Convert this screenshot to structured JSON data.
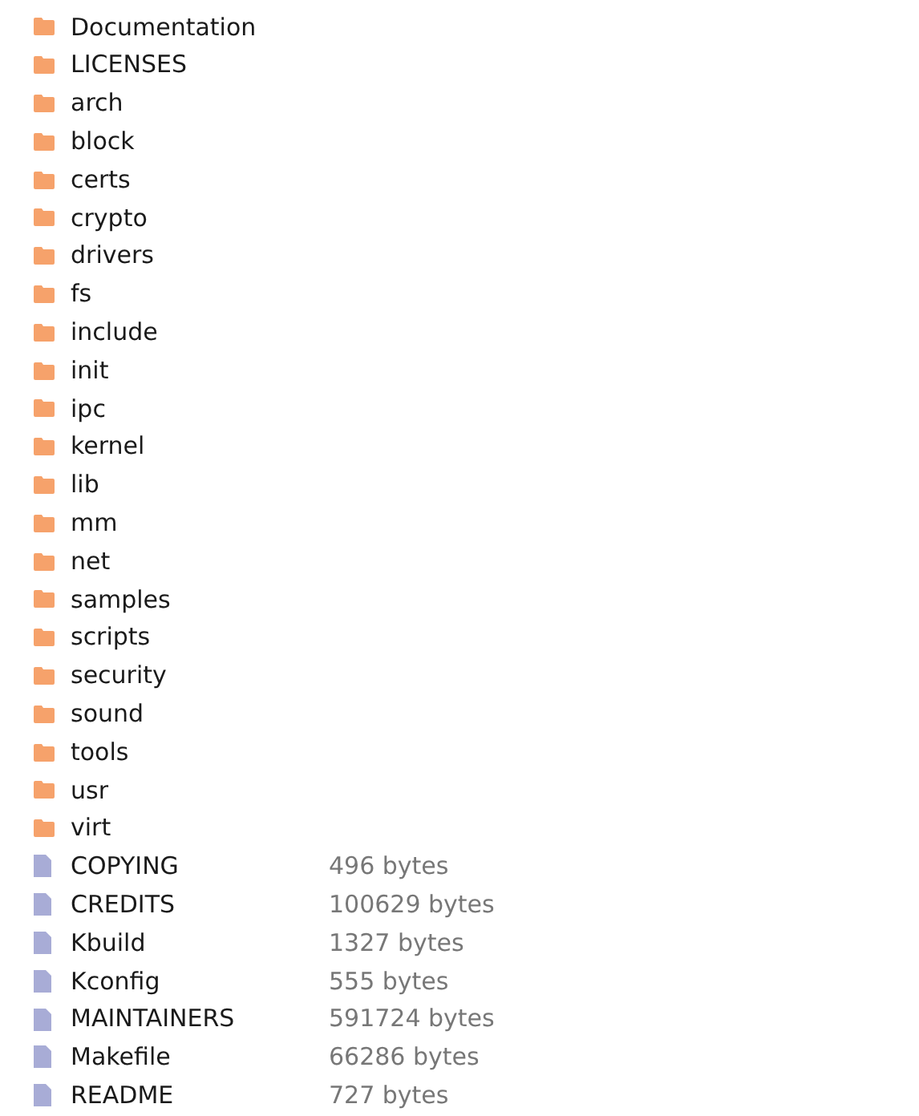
{
  "entries": [
    {
      "kind": "folder",
      "name": "Documentation"
    },
    {
      "kind": "folder",
      "name": "LICENSES"
    },
    {
      "kind": "folder",
      "name": "arch"
    },
    {
      "kind": "folder",
      "name": "block"
    },
    {
      "kind": "folder",
      "name": "certs"
    },
    {
      "kind": "folder",
      "name": "crypto"
    },
    {
      "kind": "folder",
      "name": "drivers"
    },
    {
      "kind": "folder",
      "name": "fs"
    },
    {
      "kind": "folder",
      "name": "include"
    },
    {
      "kind": "folder",
      "name": "init"
    },
    {
      "kind": "folder",
      "name": "ipc"
    },
    {
      "kind": "folder",
      "name": "kernel"
    },
    {
      "kind": "folder",
      "name": "lib"
    },
    {
      "kind": "folder",
      "name": "mm"
    },
    {
      "kind": "folder",
      "name": "net"
    },
    {
      "kind": "folder",
      "name": "samples"
    },
    {
      "kind": "folder",
      "name": "scripts"
    },
    {
      "kind": "folder",
      "name": "security"
    },
    {
      "kind": "folder",
      "name": "sound"
    },
    {
      "kind": "folder",
      "name": "tools"
    },
    {
      "kind": "folder",
      "name": "usr"
    },
    {
      "kind": "folder",
      "name": "virt"
    },
    {
      "kind": "file",
      "name": "COPYING",
      "size": "496 bytes"
    },
    {
      "kind": "file",
      "name": "CREDITS",
      "size": "100629 bytes"
    },
    {
      "kind": "file",
      "name": "Kbuild",
      "size": "1327 bytes"
    },
    {
      "kind": "file",
      "name": "Kconfig",
      "size": "555 bytes"
    },
    {
      "kind": "file",
      "name": "MAINTAINERS",
      "size": "591724 bytes"
    },
    {
      "kind": "file",
      "name": "Makefile",
      "size": "66286 bytes"
    },
    {
      "kind": "file",
      "name": "README",
      "size": "727 bytes"
    }
  ]
}
